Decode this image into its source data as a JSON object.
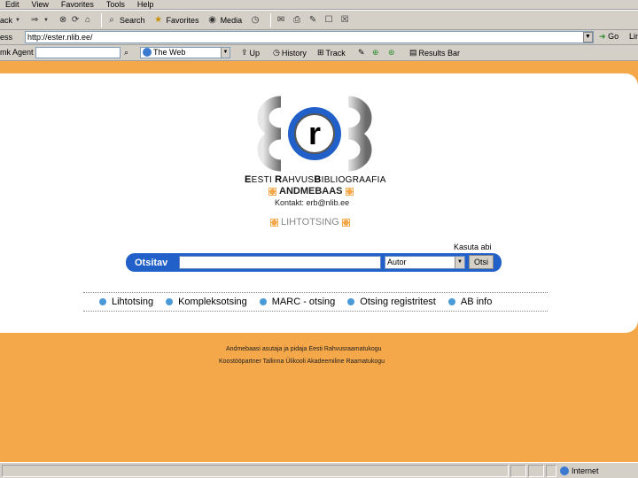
{
  "menu": [
    "Edit",
    "View",
    "Favorites",
    "Tools",
    "Help"
  ],
  "toolbar": {
    "back": "ack",
    "search": "Search",
    "favorites": "Favorites",
    "media": "Media"
  },
  "address": {
    "label": "ess",
    "url": "http://ester.nlib.ee/",
    "go": "Go",
    "links": "Lin"
  },
  "googlebar": {
    "label": "mk Agent",
    "scope": "The Web",
    "up": "Up",
    "history": "History",
    "track": "Track",
    "results": "Results Bar"
  },
  "site": {
    "title_1": "E",
    "title_2": "ESTI ",
    "title_3": "R",
    "title_4": "AHVUS",
    "title_5": "B",
    "title_6": "IBLIOGRAAFIA",
    "database": "ANDMEBAAS",
    "contact": "Kontakt: erb@nlib.ee",
    "mode_title": "LIHTOTSING"
  },
  "search": {
    "help_link": "Kasuta abi",
    "label": "Otsitav",
    "field_select": "Autor",
    "button": "Otsi"
  },
  "nav": [
    "Lihtotsing",
    "Kompleksotsing",
    "MARC - otsing",
    "Otsing registritest",
    "AB info"
  ],
  "footer": {
    "line1": "Andmebaasi asutaja ja pidaja Eesti Rahvusraamatukogu",
    "line2": "Koostööpartner Tallinna Ülikooli Akadeemiline Raamatukogu"
  },
  "status": {
    "zone": "Internet"
  },
  "colors": {
    "accent": "#f5a84a",
    "searchbar": "#2060c8"
  }
}
